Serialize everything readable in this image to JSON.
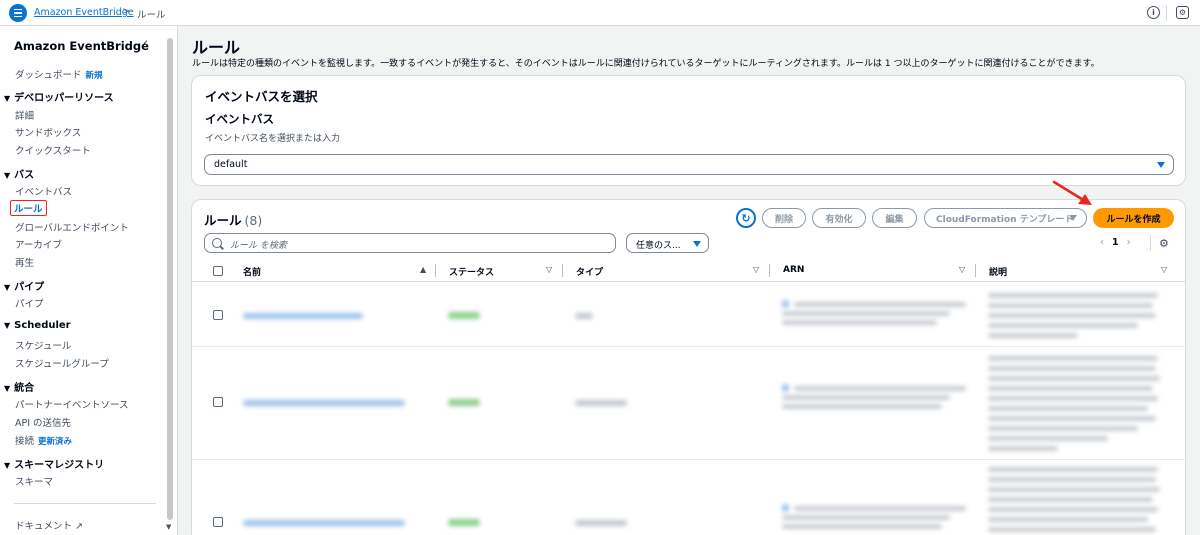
{
  "topbar": {
    "breadcrumb": [
      "Amazon EventBridge",
      "ルール"
    ],
    "separator": ">"
  },
  "sidebar": {
    "title": "Amazon EventBridge",
    "dashboard": "ダッシュボード",
    "dashboard_badge": "新規",
    "sections": {
      "dev": "デベロッパーリソース",
      "bus": "バス",
      "pipes": "パイプ",
      "scheduler": "Scheduler",
      "integration": "統合",
      "registry": "スキーマレジストリ"
    },
    "items": {
      "details": "詳細",
      "sandbox": "サンドボックス",
      "quickstart": "クイックスタート",
      "eventbus": "イベントバス",
      "rules": "ルール",
      "global": "グローバルエンドポイント",
      "archive": "アーカイブ",
      "replay": "再生",
      "pipe": "パイプ",
      "schedule": "スケジュール",
      "schedule_group": "スケジュールグループ",
      "partner": "パートナーイベントソース",
      "api_dest": "API の送信先",
      "connection": "接続",
      "connection_badge": "更新済み",
      "schema": "スキーマ"
    },
    "documentation": "ドキュメント"
  },
  "main": {
    "title": "ルール",
    "description": "ルールは特定の種類のイベントを監視します。一致するイベントが発生すると、そのイベントはルールに関連付けられているターゲットにルーティングされます。ルールは 1 つ以上のターゲットに関連付けることができます。",
    "bus_panel": {
      "header": "イベントバスを選択",
      "label": "イベントバス",
      "hint": "イベントバス名を選択または入力",
      "value": "default"
    },
    "rules_panel": {
      "title": "ルール",
      "count": "(8)",
      "buttons": {
        "delete": "削除",
        "enable": "有効化",
        "edit": "編集",
        "cloudformation": "CloudFormation テンプレート",
        "create": "ルールを作成"
      },
      "search_placeholder": "ルール を検索",
      "filter_value": "任意のス...",
      "page": "1",
      "columns": [
        "名前",
        "ステータス",
        "タイプ",
        "ARN",
        "説明"
      ]
    }
  },
  "colors": {
    "accent": "#0972d3",
    "primary_button": "#ff9900",
    "highlight_border": "#e8281d"
  }
}
